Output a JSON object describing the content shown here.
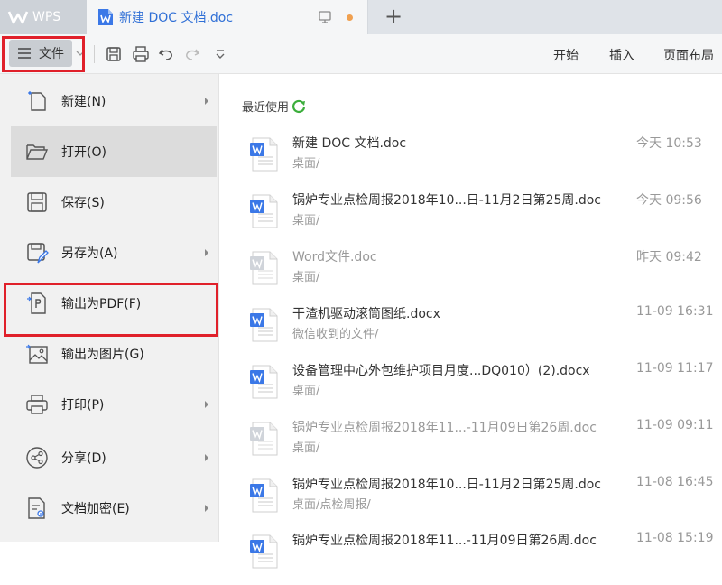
{
  "window": {
    "app_name": "WPS",
    "doc_tab_title": "新建 DOC 文档.doc",
    "new_tab_label": "+"
  },
  "toolbar": {
    "file_menu_label": "文件",
    "ribbon_tabs": [
      "开始",
      "插入",
      "页面布局"
    ]
  },
  "file_menu": {
    "items": [
      {
        "label": "新建(N)",
        "icon": "new-file-icon",
        "has_submenu": true
      },
      {
        "label": "打开(O)",
        "icon": "open-folder-icon",
        "has_submenu": false
      },
      {
        "label": "保存(S)",
        "icon": "save-icon",
        "has_submenu": false
      },
      {
        "label": "另存为(A)",
        "icon": "save-as-icon",
        "has_submenu": true
      },
      {
        "label": "输出为PDF(F)",
        "icon": "export-pdf-icon",
        "has_submenu": false
      },
      {
        "label": "输出为图片(G)",
        "icon": "export-image-icon",
        "has_submenu": false
      },
      {
        "label": "打印(P)",
        "icon": "print-icon",
        "has_submenu": true
      },
      {
        "label": "分享(D)",
        "icon": "share-icon",
        "has_submenu": true
      },
      {
        "label": "文档加密(E)",
        "icon": "encrypt-icon",
        "has_submenu": true
      }
    ],
    "active_item": "打开(O)"
  },
  "recent": {
    "header": "最近使用",
    "files": [
      {
        "name": "新建 DOC 文档.doc",
        "path": "桌面/",
        "time": "今天 10:53",
        "dim": false
      },
      {
        "name": "锅炉专业点检周报2018年10...日-11月2日第25周.doc",
        "path": "桌面/",
        "time": "今天 09:56",
        "dim": false
      },
      {
        "name": "Word文件.doc",
        "path": "桌面/",
        "time": "昨天 09:42",
        "dim": true
      },
      {
        "name": "干渣机驱动滚筒图纸.docx",
        "path": "微信收到的文件/",
        "time": "11-09 16:31",
        "dim": false
      },
      {
        "name": "设备管理中心外包维护项目月度...DQ010）(2).docx",
        "path": "桌面/",
        "time": "11-09 11:17",
        "dim": false
      },
      {
        "name": "锅炉专业点检周报2018年11...-11月09日第26周.doc",
        "path": "桌面/",
        "time": "11-09 09:11",
        "dim": true
      },
      {
        "name": "锅炉专业点检周报2018年10...日-11月2日第25周.doc",
        "path": "桌面/点检周报/",
        "time": "11-08 16:45",
        "dim": false
      },
      {
        "name": "锅炉专业点检周报2018年11...-11月09日第26周.doc",
        "path": "",
        "time": "11-08 15:19",
        "dim": false
      }
    ]
  },
  "colors": {
    "accent_blue": "#2f6fd6",
    "highlight_red": "#e0202a",
    "refresh_green": "#3cae3c"
  }
}
